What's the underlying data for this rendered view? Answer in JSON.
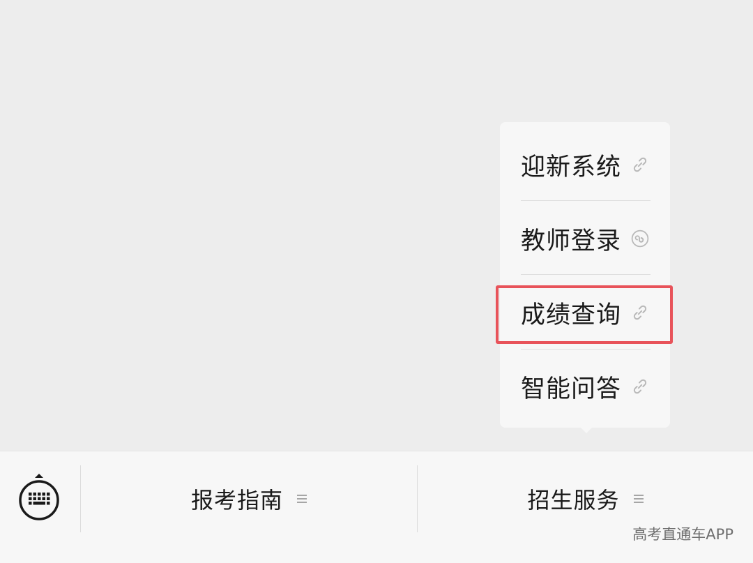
{
  "submenu": {
    "items": [
      {
        "label": "迎新系统",
        "icon": "link-icon"
      },
      {
        "label": "教师登录",
        "icon": "mini-program-icon"
      },
      {
        "label": "成绩查询",
        "icon": "link-icon"
      },
      {
        "label": "智能问答",
        "icon": "link-icon"
      }
    ],
    "highlighted_index": 2,
    "highlight_color": "#e8535a"
  },
  "menu_bar": {
    "keyboard_icon": "keyboard-toggle-icon",
    "tabs": [
      {
        "label": "报考指南",
        "icon": "hamburger-icon"
      },
      {
        "label": "招生服务",
        "icon": "hamburger-icon"
      }
    ]
  },
  "watermark": "高考直通车APP",
  "colors": {
    "background": "#ededed",
    "menu_bar": "#f7f7f7",
    "text": "#1a1a1a"
  }
}
